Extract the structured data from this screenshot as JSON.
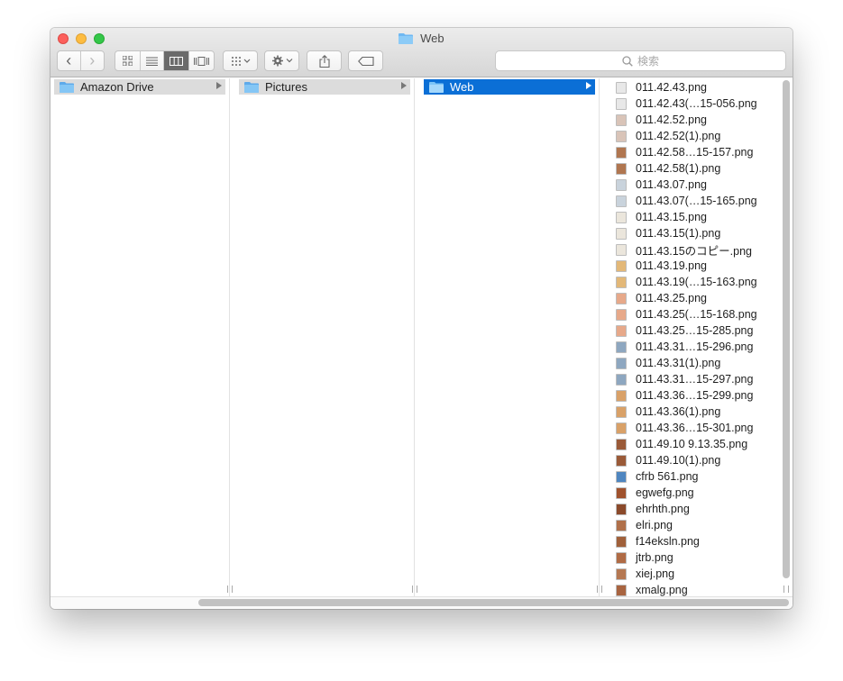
{
  "window": {
    "title": "Web"
  },
  "toolbar": {
    "back_label": "‹",
    "forward_label": "›",
    "search_placeholder": "検索"
  },
  "columns": [
    {
      "label": "Amazon Drive",
      "state": "inactive"
    },
    {
      "label": "Pictures",
      "state": "inactive"
    },
    {
      "label": "Web",
      "state": "active"
    }
  ],
  "files": [
    {
      "name": "011.42.43.png",
      "thumb": "#e8e8e8"
    },
    {
      "name": "011.42.43(…15-056.png",
      "thumb": "#e8e8e8"
    },
    {
      "name": "011.42.52.png",
      "thumb": "#d9c4b8"
    },
    {
      "name": "011.42.52(1).png",
      "thumb": "#d9c4b8"
    },
    {
      "name": "011.42.58…15-157.png",
      "thumb": "#b07650"
    },
    {
      "name": "011.42.58(1).png",
      "thumb": "#b07650"
    },
    {
      "name": "011.43.07.png",
      "thumb": "#c9d3dc"
    },
    {
      "name": "011.43.07(…15-165.png",
      "thumb": "#c9d3dc"
    },
    {
      "name": "011.43.15.png",
      "thumb": "#ebe6dc"
    },
    {
      "name": "011.43.15(1).png",
      "thumb": "#ebe6dc"
    },
    {
      "name": "011.43.15のコピー.png",
      "thumb": "#ebe6dc"
    },
    {
      "name": "011.43.19.png",
      "thumb": "#e3b878"
    },
    {
      "name": "011.43.19(…15-163.png",
      "thumb": "#e3b878"
    },
    {
      "name": "011.43.25.png",
      "thumb": "#e7a98a"
    },
    {
      "name": "011.43.25(…15-168.png",
      "thumb": "#e7a98a"
    },
    {
      "name": "011.43.25…15-285.png",
      "thumb": "#e7a98a"
    },
    {
      "name": "011.43.31…15-296.png",
      "thumb": "#8ea7c0"
    },
    {
      "name": "011.43.31(1).png",
      "thumb": "#8ea7c0"
    },
    {
      "name": "011.43.31…15-297.png",
      "thumb": "#8ea7c0"
    },
    {
      "name": "011.43.36…15-299.png",
      "thumb": "#d9a168"
    },
    {
      "name": "011.43.36(1).png",
      "thumb": "#d9a168"
    },
    {
      "name": "011.43.36…15-301.png",
      "thumb": "#d9a168"
    },
    {
      "name": "011.49.10 9.13.35.png",
      "thumb": "#9a5a38"
    },
    {
      "name": "011.49.10(1).png",
      "thumb": "#9a5a38"
    },
    {
      "name": "cfrb 561.png",
      "thumb": "#4f86c0"
    },
    {
      "name": "egwefg.png",
      "thumb": "#a0522d"
    },
    {
      "name": "ehrhth.png",
      "thumb": "#8b4a2b"
    },
    {
      "name": "elri.png",
      "thumb": "#b0704a"
    },
    {
      "name": "f14eksln.png",
      "thumb": "#a0603a"
    },
    {
      "name": "jtrb.png",
      "thumb": "#b06b45"
    },
    {
      "name": "xiej.png",
      "thumb": "#b57852"
    },
    {
      "name": "xmalg.png",
      "thumb": "#a86440"
    }
  ],
  "colors": {
    "selection_active": "#0b6fd6",
    "selection_inactive": "#dcdcdc",
    "folder": "#6fb8f2"
  }
}
